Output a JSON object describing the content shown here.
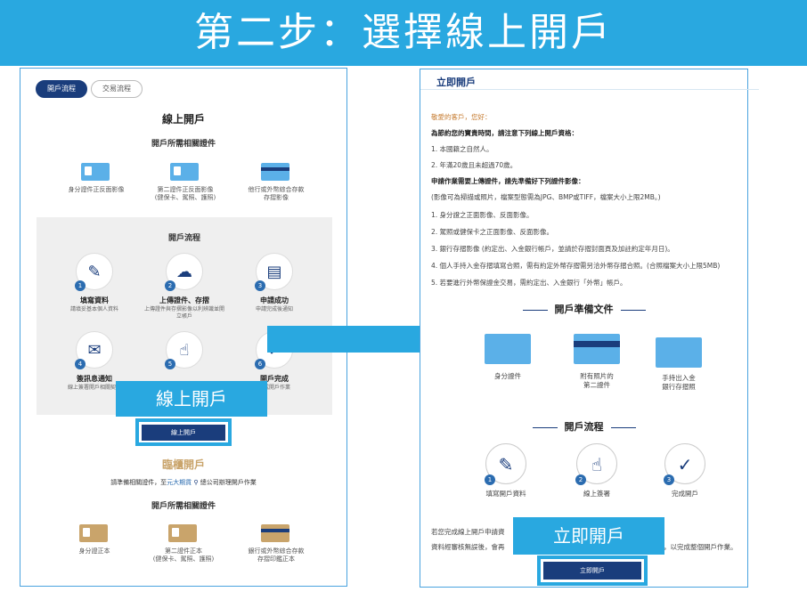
{
  "banner": {
    "title": "第二步：選擇線上開戶"
  },
  "left": {
    "tabs": [
      "開戶流程",
      "交易流程"
    ],
    "online": {
      "title": "線上開戶",
      "docs_title": "開戶所需相關證件",
      "docs": [
        {
          "line1": "身分證件正反面影像",
          "line2": ""
        },
        {
          "line1": "第二證件正反面影像",
          "line2": "(健保卡、駕照、護照)"
        },
        {
          "line1": "他行或外幣綜合存款",
          "line2": "存摺影像"
        }
      ],
      "process_title": "開戶流程",
      "steps": [
        {
          "num": "1",
          "label": "填寫資料",
          "desc": "請填妥基本個人資料"
        },
        {
          "num": "2",
          "label": "上傳證件、存摺",
          "desc": "上傳證件與存摺影像以利辨識並開立帳戶"
        },
        {
          "num": "3",
          "label": "申請成功",
          "desc": "申請完成後通知"
        },
        {
          "num": "4",
          "label": "簽訊息通知",
          "desc": "線上簽署開戶相關契約"
        },
        {
          "num": "5",
          "label": "",
          "desc": ""
        },
        {
          "num": "6",
          "label": "開戶完成",
          "desc": "完成開戶作業"
        }
      ],
      "callout": "線上開戶",
      "button": "線上開戶"
    },
    "counter": {
      "title": "臨櫃開戶",
      "note": "請準備相關證件，至",
      "link": "元大期貨",
      "note2": "總公司辦理開戶作業",
      "docs_title": "開戶所需相關證件",
      "docs": [
        {
          "line1": "身分證正本",
          "line2": ""
        },
        {
          "line1": "第二證件正本",
          "line2": "(健保卡、駕照、護照)"
        },
        {
          "line1": "銀行或外幣綜合存款",
          "line2": "存摺印鑑正本"
        }
      ]
    }
  },
  "right": {
    "heading": "立即開戶",
    "lines": [
      {
        "text": "敬愛的客戶，您好：",
        "style": "orange"
      },
      {
        "text": "為節約您的寶貴時間，請注意下列線上開戶資格：",
        "style": "bold"
      },
      {
        "text": "1. 本國籍之自然人。",
        "style": ""
      },
      {
        "text": "2. 年滿20歲且未超過70歲。",
        "style": ""
      },
      {
        "text": "申請作業需要上傳證件，請先準備好下列證件影像：",
        "style": "bold"
      },
      {
        "text": "(影像可為掃描或照片，檔案型態需為JPG、BMP或TIFF，檔案大小上限2MB。)",
        "style": ""
      },
      {
        "text": "1. 身分證之正面影像、反面影像。",
        "style": ""
      },
      {
        "text": "2. 駕照或健保卡之正面影像、反面影像。",
        "style": ""
      },
      {
        "text": "3. 銀行存摺影像 (約定出、入金銀行帳戶，並請於存摺封面頁及加註約定年月日)。",
        "style": ""
      },
      {
        "text": "4. 個人手持入金存摺填寫合照，需有約定外幣存摺需另洽外幣存摺合照。(合照檔案大小上限5MB)",
        "style": ""
      },
      {
        "text": "5. 若要進行外幣保證金交易，需約定出、入金銀行「外幣」帳戶。",
        "style": ""
      }
    ],
    "prep_title": "開戶準備文件",
    "prep_docs": [
      {
        "line1": "身分證件",
        "line2": ""
      },
      {
        "line1": "附有照片的",
        "line2": "第二證件"
      },
      {
        "line1": "手持出入金",
        "line2": "銀行存摺照"
      }
    ],
    "process_title": "開戶流程",
    "steps": [
      {
        "num": "1",
        "label": "填寫開戶資料"
      },
      {
        "num": "2",
        "label": "線上簽署"
      },
      {
        "num": "3",
        "label": "完成開戶"
      }
    ],
    "bottom_text_1": "若您完成線上開戶申請資",
    "bottom_text_2": "資料經審核無誤後，會再",
    "bottom_text_3": "，以完成整個開戶作業。",
    "callout": "立即開戶",
    "button": "立即開戶"
  },
  "colors": {
    "accent": "#29a8e0",
    "navy": "#1a3d7c"
  }
}
